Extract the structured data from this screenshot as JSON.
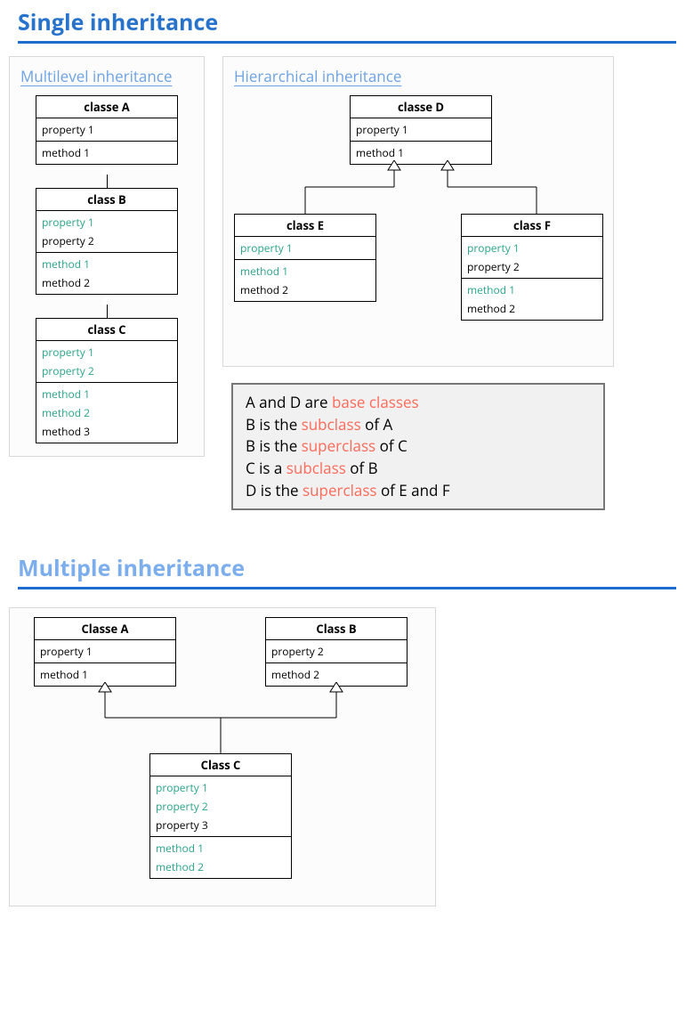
{
  "headings": {
    "single": "Single inheritance",
    "multiple": "Multiple inheritance",
    "multilevel": "Multilevel inheritance",
    "hierarchical": "Hierarchical inheritance"
  },
  "ml": {
    "a": {
      "name": "classe A",
      "props": [
        "property 1"
      ],
      "methods": [
        "method 1"
      ],
      "inheritedProps": [],
      "inheritedMethods": []
    },
    "b": {
      "name": "class B",
      "inheritedProps": [
        "property 1"
      ],
      "props": [
        "property 2"
      ],
      "inheritedMethods": [
        "method 1"
      ],
      "methods": [
        "method 2"
      ]
    },
    "c": {
      "name": "class C",
      "inheritedProps": [
        "property 1",
        "property 2"
      ],
      "props": [],
      "inheritedMethods": [
        "method 1",
        "method 2"
      ],
      "methods": [
        "method 3"
      ]
    }
  },
  "hi": {
    "d": {
      "name": "classe D",
      "props": [
        "property 1"
      ],
      "methods": [
        "method 1"
      ],
      "inheritedProps": [],
      "inheritedMethods": []
    },
    "e": {
      "name": "class E",
      "inheritedProps": [
        "property 1"
      ],
      "props": [],
      "inheritedMethods": [
        "method 1"
      ],
      "methods": [
        "method 2"
      ]
    },
    "f": {
      "name": "class F",
      "inheritedProps": [
        "property 1"
      ],
      "props": [
        "property 2"
      ],
      "inheritedMethods": [
        "method 1"
      ],
      "methods": [
        "method 2"
      ]
    }
  },
  "mu": {
    "a": {
      "name": "Classe A",
      "props": [
        "property 1"
      ],
      "methods": [
        "method 1"
      ],
      "inheritedProps": [],
      "inheritedMethods": []
    },
    "b": {
      "name": "Class B",
      "props": [
        "property 2"
      ],
      "methods": [
        "method 2"
      ],
      "inheritedProps": [],
      "inheritedMethods": []
    },
    "c": {
      "name": "Class C",
      "inheritedProps": [
        "property 1",
        "property 2"
      ],
      "props": [
        "property 3"
      ],
      "inheritedMethods": [
        "method 1",
        "method 2"
      ],
      "methods": []
    }
  },
  "note": {
    "l1a": "A and D are ",
    "l1b": "base classes",
    "l2a": "B is the ",
    "l2b": "subclass",
    "l2c": " of A",
    "l3a": "B is the ",
    "l3b": "superclass",
    "l3c": " of C",
    "l4a": "C is a ",
    "l4b": "subclass",
    "l4c": " of B",
    "l5a": "D is the ",
    "l5b": "superclass",
    "l5c": " of E and F"
  }
}
